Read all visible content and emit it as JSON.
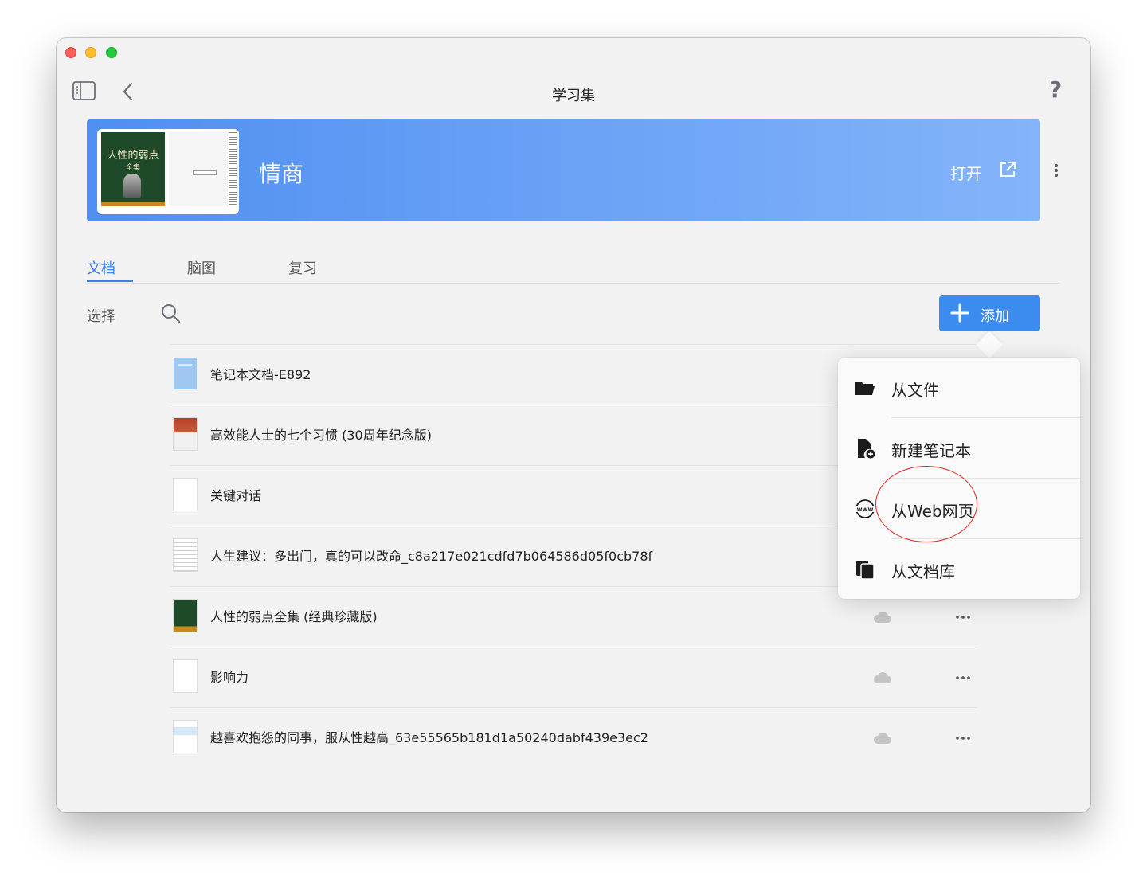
{
  "window": {
    "title": "学习集"
  },
  "toolbar": {
    "help": "?"
  },
  "banner": {
    "title": "情商",
    "open_label": "打开",
    "cover_title": "人性的弱点",
    "cover_subtitle": "全集"
  },
  "tabs": [
    {
      "label": "文档",
      "active": true
    },
    {
      "label": "脑图",
      "active": false
    },
    {
      "label": "复习",
      "active": false
    }
  ],
  "actions": {
    "select_label": "选择",
    "add_label": "添加"
  },
  "documents": [
    {
      "title": "笔记本文档-E892",
      "thumb": "notebook"
    },
    {
      "title": "高效能人士的七个习惯 (30周年纪念版)",
      "thumb": "book-cover"
    },
    {
      "title": "关键对话",
      "thumb": "blank"
    },
    {
      "title": "人生建议：多出门，真的可以改命_c8a217e021cdfd7b064586d05f0cb78f",
      "thumb": "text-page"
    },
    {
      "title": "人性的弱点全集 (经典珍藏版)",
      "thumb": "book-cover-green"
    },
    {
      "title": "影响力",
      "thumb": "blank"
    },
    {
      "title": "越喜欢抱怨的同事，服从性越高_63e55565b181d1a50240dabf439e3ec2",
      "thumb": "web-page"
    }
  ],
  "add_menu": {
    "items": [
      {
        "label": "从文件",
        "icon": "folder-icon"
      },
      {
        "label": "新建笔记本",
        "icon": "new-document-icon"
      },
      {
        "label": "从Web网页",
        "icon": "www-globe-icon",
        "highlighted": true
      },
      {
        "label": "从文档库",
        "icon": "library-copy-icon"
      }
    ]
  },
  "colors": {
    "accent": "#3c8cf0",
    "banner_start": "#4f8ff2",
    "banner_end": "#84b4fa",
    "highlight_ring": "#e02222"
  }
}
